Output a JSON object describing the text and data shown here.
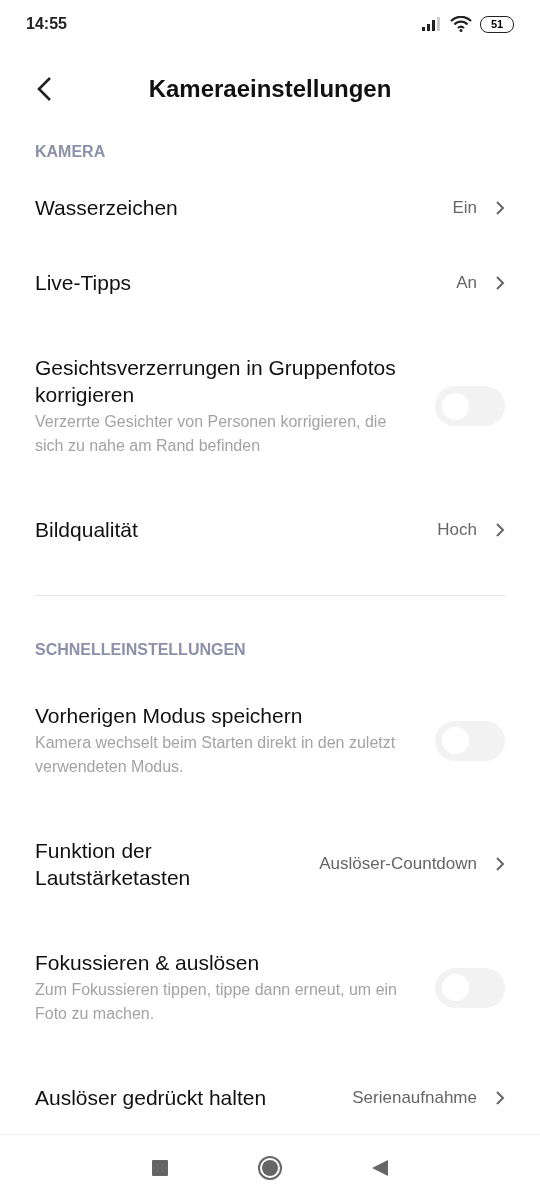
{
  "status_bar": {
    "time": "14:55",
    "battery": "51"
  },
  "header": {
    "title": "Kameraeinstellungen"
  },
  "sections": [
    {
      "label": "KAMERA",
      "items": [
        {
          "kind": "link",
          "title": "Wasserzeichen",
          "value": "Ein"
        },
        {
          "kind": "link",
          "title": "Live-Tipps",
          "value": "An"
        },
        {
          "kind": "toggle",
          "title": "Gesichtsverzerrungen in Gruppenfotos korrigieren",
          "description": "Verzerrte Gesichter von Personen korrigieren, die sich zu nahe am Rand befinden",
          "on": false
        },
        {
          "kind": "link",
          "title": "Bildqualität",
          "value": "Hoch"
        }
      ]
    },
    {
      "label": "SCHNELLEINSTELLUNGEN",
      "items": [
        {
          "kind": "toggle",
          "title": "Vorherigen Modus speichern",
          "description": "Kamera wechselt beim Starten direkt in den zuletzt verwendeten Modus.",
          "on": false
        },
        {
          "kind": "link",
          "title": "Funktion der Lautstärketasten",
          "value": "Auslöser-Countdown"
        },
        {
          "kind": "toggle",
          "title": "Fokussieren & auslösen",
          "description": "Zum Fokussieren tippen, tippe dann erneut, um ein Foto zu machen.",
          "on": false
        },
        {
          "kind": "link",
          "title": "Auslöser gedrückt halten",
          "value": "Serienaufnahme"
        }
      ]
    }
  ]
}
